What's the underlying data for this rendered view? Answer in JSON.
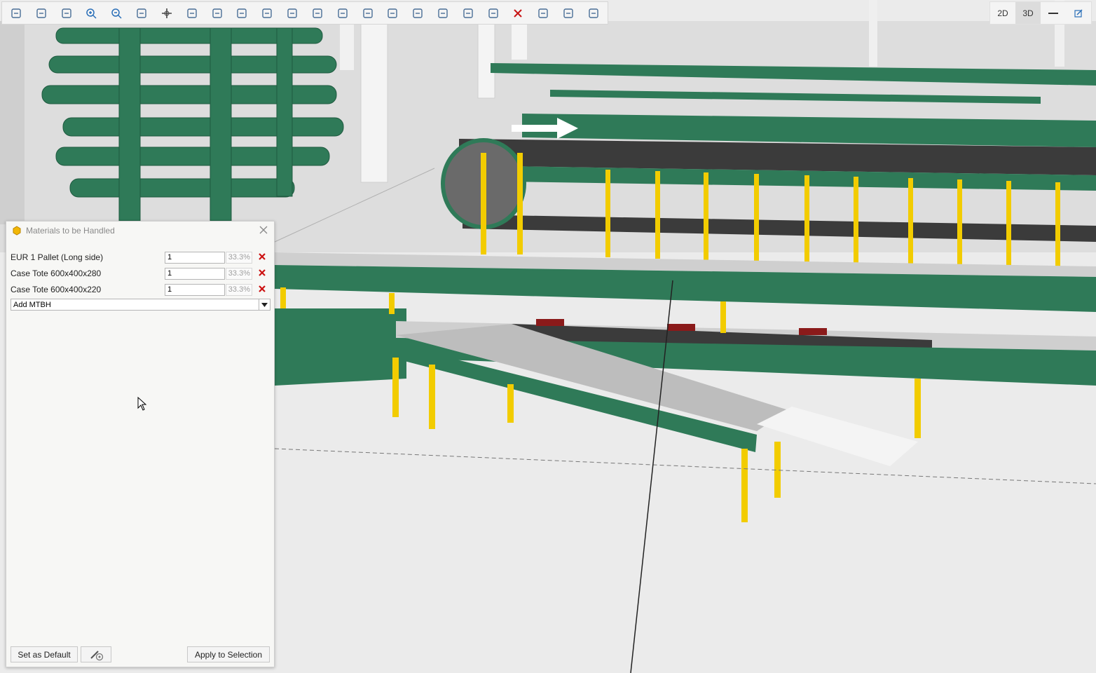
{
  "toolbar": {
    "icons": [
      "select-icon",
      "select-area-icon",
      "zoom-extents-icon",
      "zoom-in-icon",
      "zoom-out-icon",
      "zoom-window-icon",
      "pan-icon",
      "orbit-icon",
      "fit-icon",
      "insert-icon",
      "camera-icon",
      "film-icon",
      "tag-icon",
      "arrows-icon",
      "ruler-icon",
      "snap-icon",
      "frame-icon",
      "comment-icon",
      "connect-icon",
      "scale-icon",
      "delete-icon",
      "cut-icon",
      "measure-icon",
      "link-icon"
    ]
  },
  "view_toggle": {
    "mode_2d": "2D",
    "mode_3d": "3D",
    "active": "3D"
  },
  "dialog": {
    "title": "Materials to be Handled",
    "materials": [
      {
        "name": "EUR 1 Pallet (Long side)",
        "quantity": "1",
        "percent": "33.3%"
      },
      {
        "name": "Case Tote 600x400x280",
        "quantity": "1",
        "percent": "33.3%"
      },
      {
        "name": "Case Tote 600x400x220",
        "quantity": "1",
        "percent": "33.3%"
      }
    ],
    "add_placeholder": "Add MTBH",
    "set_default_label": "Set as Default",
    "apply_label": "Apply to Selection"
  },
  "colors": {
    "conveyor_green": "#2f7a58",
    "leg_yellow": "#f2cc00",
    "belt_dark": "#3b3b3b",
    "delete_red": "#cc1111"
  }
}
